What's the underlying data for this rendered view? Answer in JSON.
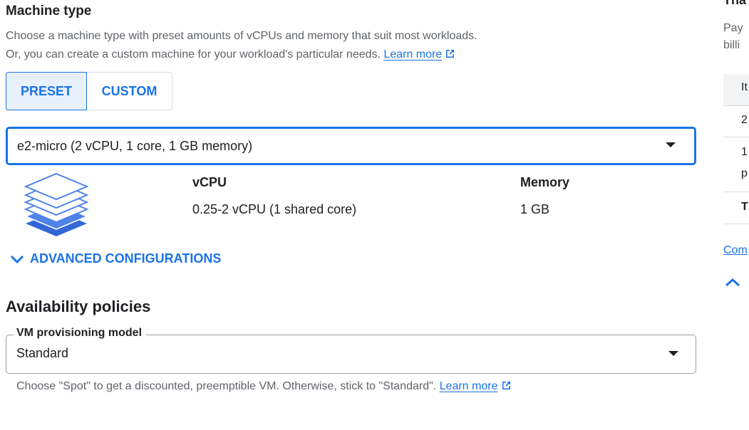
{
  "machine_type": {
    "heading": "Machine type",
    "description_line1": "Choose a machine type with preset amounts of vCPUs and memory that suit most workloads.",
    "description_line2": "Or, you can create a custom machine for your workload's particular needs.",
    "learn_more": "Learn more",
    "tabs": [
      {
        "label": "PRESET",
        "selected": true
      },
      {
        "label": "CUSTOM",
        "selected": false
      }
    ],
    "selected_machine": "e2-micro (2 vCPU, 1 core, 1 GB memory)",
    "specs": {
      "vcpu_label": "vCPU",
      "vcpu_value": "0.25-2 vCPU (1 shared core)",
      "memory_label": "Memory",
      "memory_value": "1 GB"
    },
    "icon": "layers-icon"
  },
  "advanced": {
    "label": "ADVANCED CONFIGURATIONS",
    "icon": "chevron-down-icon"
  },
  "availability": {
    "heading": "Availability policies",
    "field_label": "VM provisioning model",
    "field_value": "Standard",
    "helper": "Choose \"Spot\" to get a discounted, preemptible VM. Otherwise, stick to \"Standard\".",
    "learn_more": "Learn more"
  },
  "right_panel": {
    "title_fragment": "Tha",
    "text_fragment_1": "Pay",
    "text_fragment_2": "billi",
    "table_header_fragment": "It",
    "row1_fragment": "2",
    "row2_fragment_a": "1",
    "row2_fragment_b": "p",
    "row3_fragment": "T",
    "link_fragment": "Com"
  },
  "colors": {
    "accent": "#1a73e8",
    "selected_bg": "#e8f0fe",
    "text": "#202124",
    "muted": "#5f6368"
  }
}
